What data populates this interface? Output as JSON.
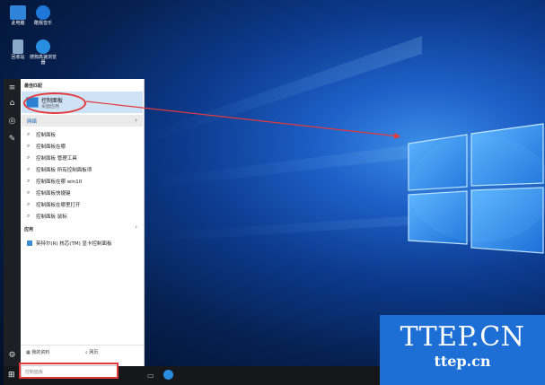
{
  "desktop": {
    "icons": [
      {
        "label": "此电脑",
        "icon": "computer-icon",
        "color": "#2f84d9"
      },
      {
        "label": "酷我音乐",
        "icon": "music-app-icon",
        "color": "#1f78d8"
      },
      {
        "label": "回收站",
        "icon": "recycle-bin-icon",
        "color": "#8aa9c8"
      },
      {
        "label": "搜狗高速浏览器",
        "icon": "browser-icon",
        "color": "#2a8ee0"
      }
    ]
  },
  "start_menu": {
    "best_match_title": "最佳匹配",
    "best_match": {
      "title": "控制面板",
      "subtitle": "桌面应用"
    },
    "web_label": "网络",
    "suggestions": [
      "控制面板",
      "控制面板在哪",
      "控制面板 管理工具",
      "控制面板 所有控制面板项",
      "控制面板在哪 win10",
      "控制面板快捷键",
      "控制面板在哪里打开",
      "控制面板 鼠标"
    ],
    "apps_title": "应用",
    "apps": [
      "英特尔(R) 核芯(TM) 显卡控制面板"
    ],
    "footer_left": "我的资料",
    "footer_right": "网页"
  },
  "taskbar": {
    "search_placeholder": "控制面板"
  },
  "watermark": {
    "line1": "TTEP.CN",
    "line2": "ttep.cn"
  },
  "colors": {
    "highlight": "#e23a3a",
    "accent": "#2a7fd0",
    "watermark_bg": "#1d6fd6"
  }
}
